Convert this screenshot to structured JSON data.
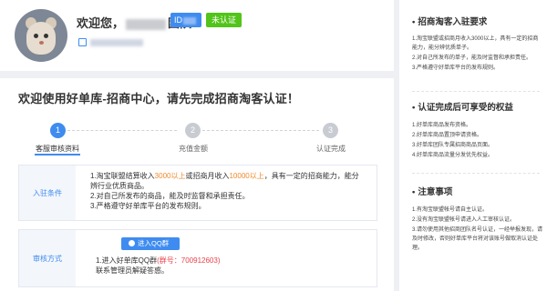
{
  "profile": {
    "welcome_prefix": "欢迎您，",
    "welcome_suffix": "团队",
    "id_label": "ID",
    "cert_status": "未认证"
  },
  "main": {
    "title": "欢迎使用好单库-招商中心，请先完成招商淘客认证！"
  },
  "steps": [
    {
      "num": "1",
      "label": "客服审核资料",
      "active": true
    },
    {
      "num": "2",
      "label": "充值金额",
      "active": false
    },
    {
      "num": "3",
      "label": "认证完成",
      "active": false
    }
  ],
  "conditions": {
    "label": "入驻条件",
    "line1_a": "1.淘宝联盟结算收入",
    "line1_amount1": "3000以上",
    "line1_b": "或招商月收入",
    "line1_amount2": "10000以上",
    "line1_c": "，具有一定的招商能力，能分辨行业优质商品。",
    "line2": "2.对自己所发布的商品，能及时监督和承担责任。",
    "line3": "3.严格遵守好单库平台的发布规则。"
  },
  "method": {
    "label": "审核方式",
    "qq_button": "进入QQ群",
    "line1_a": "1.进入好单库QQ群",
    "line1_group": "(群号：700912603)",
    "line2": "联系管理员解疑答惑。"
  },
  "sidebar": {
    "requirements_title": "招商淘客入驻要求",
    "requirements": [
      "1.淘宝联盟或招商月收入3000以上，具有一定的招商能力，能分辨优质单子。",
      "2.对自己所发布的单子，能及时监督和承担责任。",
      "3.严格遵守好单库平台的发布规则。"
    ],
    "benefits_title": "认证完成后可享受的权益",
    "benefits": [
      "1.好单库商品发布资格。",
      "2.好单库商品置顶申请资格。",
      "3.好单库团队专属招商商品页面。",
      "4.好单库商品流量分发优先权益。"
    ],
    "notes_title": "注意事项",
    "notes": [
      "1.有淘宝联盟帐号请自主认证。",
      "2.没有淘宝联盟帐号请进入人工审核认证。",
      "3.请勿使用其他招商团队名号认证，一经举报发现，请及时修改，否则好单库平台将对该账号做取消认证处理。"
    ]
  }
}
